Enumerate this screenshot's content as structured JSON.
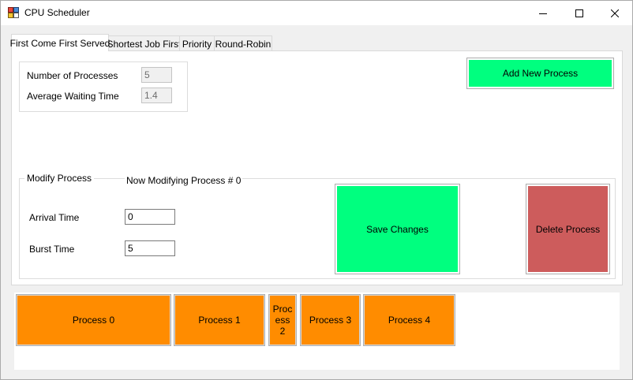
{
  "window": {
    "title": "CPU Scheduler"
  },
  "tabs": [
    {
      "label": "First Come First Served",
      "active": true
    },
    {
      "label": "Shortest Job First",
      "active": false
    },
    {
      "label": "Priority",
      "active": false
    },
    {
      "label": "Round-Robin",
      "active": false
    }
  ],
  "summary": {
    "num_processes_label": "Number of Processes",
    "num_processes_value": "5",
    "avg_wait_label": "Average Waiting Time",
    "avg_wait_value": "1.4"
  },
  "add_button_label": "Add New Process",
  "modify": {
    "group_title": "Modify Process",
    "now_modifying": "Now Modifying Process # 0",
    "arrival_label": "Arrival Time",
    "arrival_value": "0",
    "burst_label": "Burst Time",
    "burst_value": "5",
    "save_label": "Save Changes",
    "delete_label": "Delete Process"
  },
  "gantt": [
    {
      "label": "Process 0"
    },
    {
      "label": "Process 1"
    },
    {
      "label": "Process 2"
    },
    {
      "label": "Process 3"
    },
    {
      "label": "Process 4"
    }
  ],
  "colors": {
    "accent_green": "#00ff7f",
    "delete_red": "#cd5c5c",
    "process_orange": "#ff8c00"
  }
}
